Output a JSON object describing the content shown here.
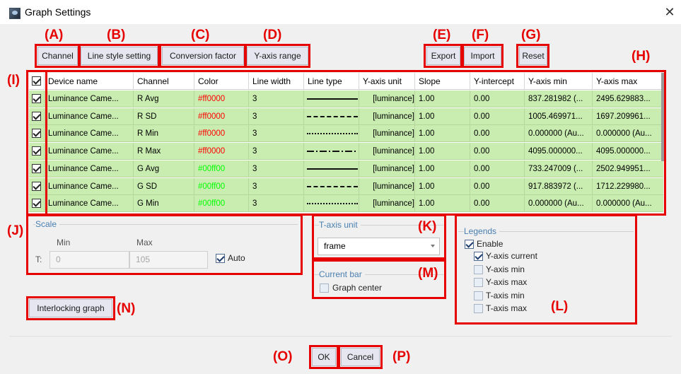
{
  "window": {
    "title": "Graph Settings",
    "close_glyph": "✕"
  },
  "toolbar": {
    "channel": "Channel",
    "line_style": "Line style setting",
    "conversion": "Conversion factor",
    "yaxis_range": "Y-axis range",
    "export": "Export",
    "import": "Import",
    "reset": "Reset"
  },
  "callouts": {
    "A": "(A)",
    "B": "(B)",
    "C": "(C)",
    "D": "(D)",
    "E": "(E)",
    "F": "(F)",
    "G": "(G)",
    "H": "(H)",
    "I": "(I)",
    "J": "(J)",
    "K": "(K)",
    "L": "(L)",
    "M": "(M)",
    "N": "(N)",
    "O": "(O)",
    "P": "(P)"
  },
  "table": {
    "columns": [
      "Device name",
      "Channel",
      "Color",
      "Line width",
      "Line type",
      "Y-axis unit",
      "Slope",
      "Y-intercept",
      "Y-axis min",
      "Y-axis max"
    ],
    "rows": [
      {
        "checked": true,
        "device": "Luminance Came...",
        "channel": "R Avg",
        "color": "#ff0000",
        "width": "3",
        "line_type": "solid",
        "unit": "[luminance]",
        "slope": "1.00",
        "intercept": "0.00",
        "ymin": "837.281982 (...",
        "ymax": "2495.629883..."
      },
      {
        "checked": true,
        "device": "Luminance Came...",
        "channel": "R SD",
        "color": "#ff0000",
        "width": "3",
        "line_type": "dash",
        "unit": "[luminance]",
        "slope": "1.00",
        "intercept": "0.00",
        "ymin": "1005.469971...",
        "ymax": "1697.209961..."
      },
      {
        "checked": true,
        "device": "Luminance Came...",
        "channel": "R Min",
        "color": "#ff0000",
        "width": "3",
        "line_type": "dot",
        "unit": "[luminance]",
        "slope": "1.00",
        "intercept": "0.00",
        "ymin": "0.000000 (Au...",
        "ymax": "0.000000 (Au..."
      },
      {
        "checked": true,
        "device": "Luminance Came...",
        "channel": "R Max",
        "color": "#ff0000",
        "width": "3",
        "line_type": "dashdot",
        "unit": "[luminance]",
        "slope": "1.00",
        "intercept": "0.00",
        "ymin": "4095.000000...",
        "ymax": "4095.000000..."
      },
      {
        "checked": true,
        "device": "Luminance Came...",
        "channel": "G Avg",
        "color": "#00ff00",
        "width": "3",
        "line_type": "solid",
        "unit": "[luminance]",
        "slope": "1.00",
        "intercept": "0.00",
        "ymin": "733.247009 (...",
        "ymax": "2502.949951..."
      },
      {
        "checked": true,
        "device": "Luminance Came...",
        "channel": "G SD",
        "color": "#00ff00",
        "width": "3",
        "line_type": "dash",
        "unit": "[luminance]",
        "slope": "1.00",
        "intercept": "0.00",
        "ymin": "917.883972 (...",
        "ymax": "1712.229980..."
      },
      {
        "checked": true,
        "device": "Luminance Came...",
        "channel": "G Min",
        "color": "#00ff00",
        "width": "3",
        "line_type": "dot",
        "unit": "[luminance]",
        "slope": "1.00",
        "intercept": "0.00",
        "ymin": "0.000000 (Au...",
        "ymax": "0.000000 (Au..."
      }
    ]
  },
  "scale": {
    "title": "Scale",
    "min_label": "Min",
    "max_label": "Max",
    "t_label": "T:",
    "min_value": "0",
    "max_value": "105",
    "auto_label": "Auto",
    "auto_checked": true
  },
  "taxis": {
    "title": "T-axis unit",
    "value": "frame"
  },
  "current_bar": {
    "title": "Current bar",
    "graph_center": "Graph center",
    "checked": false
  },
  "legends": {
    "title": "Legends",
    "enable": "Enable",
    "items": [
      {
        "label": "Y-axis current",
        "checked": true
      },
      {
        "label": "Y-axis min",
        "checked": false
      },
      {
        "label": "Y-axis max",
        "checked": false
      },
      {
        "label": "T-axis min",
        "checked": false
      },
      {
        "label": "T-axis max",
        "checked": false
      }
    ]
  },
  "interlocking": "Interlocking graph",
  "footer": {
    "ok": "OK",
    "cancel": "Cancel"
  },
  "colors": {
    "highlight": "#e60000",
    "row_bg": "#c9ecb0",
    "red_text": "#ff0000",
    "green_text": "#00ff00"
  }
}
